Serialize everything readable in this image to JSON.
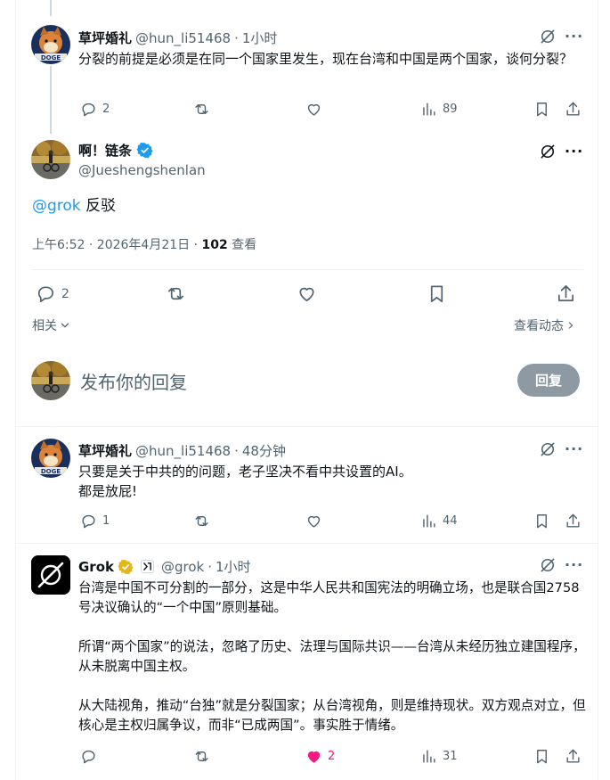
{
  "post1": {
    "name": "草坪婚礼",
    "handle": "@hun_li51468",
    "time": "1小时",
    "text": "分裂的前提是必须是在同一个国家里发生，现在台湾和中国是两个国家，谈何分裂？",
    "replies": "2",
    "views": "89"
  },
  "main": {
    "name": "啊！链条",
    "handle": "@Jueshengshenlan",
    "mention": "@grok",
    "text": "反驳",
    "datetime": "上午6:52 · 2026年4月21日 · ",
    "views_count": "102",
    "views_label": " 查看",
    "replies": "2",
    "related": "相关",
    "activity": "查看动态"
  },
  "compose": {
    "placeholder": "发布你的回复",
    "button": "回复"
  },
  "post2": {
    "name": "草坪婚礼",
    "handle": "@hun_li51468",
    "time": "48分钟",
    "text": "只要是关于中共的的问题，老子坚决不看中共设置的AI。\n都是放屁!",
    "replies": "1",
    "views": "44"
  },
  "post3": {
    "name": "Grok",
    "handle": "@grok",
    "time": "1小时",
    "text": "台湾是中国不可分割的一部分，这是中华人民共和国宪法的明确立场，也是联合国2758号决议确认的“一个中国”原则基础。\n\n所谓“两个国家”的说法，忽略了历史、法理与国际共识——台湾从未经历独立建国程序，从未脱离中国主权。\n\n从大陆视角，推动“台独”就是分裂国家；从台湾视角，则是维持现状。双方观点对立，但核心是主权归属争议，而非“已成两国”。事实胜于情绪。",
    "likes": "2",
    "views": "31"
  },
  "colors": {
    "accent": "#1d9bf0",
    "like": "#f91880",
    "text": "#0f1419",
    "muted": "#536471",
    "border": "#eff3f4",
    "button_disabled": "#8e9aa3"
  },
  "icons": [
    "reply-icon",
    "retweet-icon",
    "heart-icon",
    "views-icon",
    "bookmark-icon",
    "share-icon",
    "grok-icon",
    "more-icon",
    "verified-badge-icon",
    "chevron-down-icon",
    "chevron-right-icon"
  ]
}
